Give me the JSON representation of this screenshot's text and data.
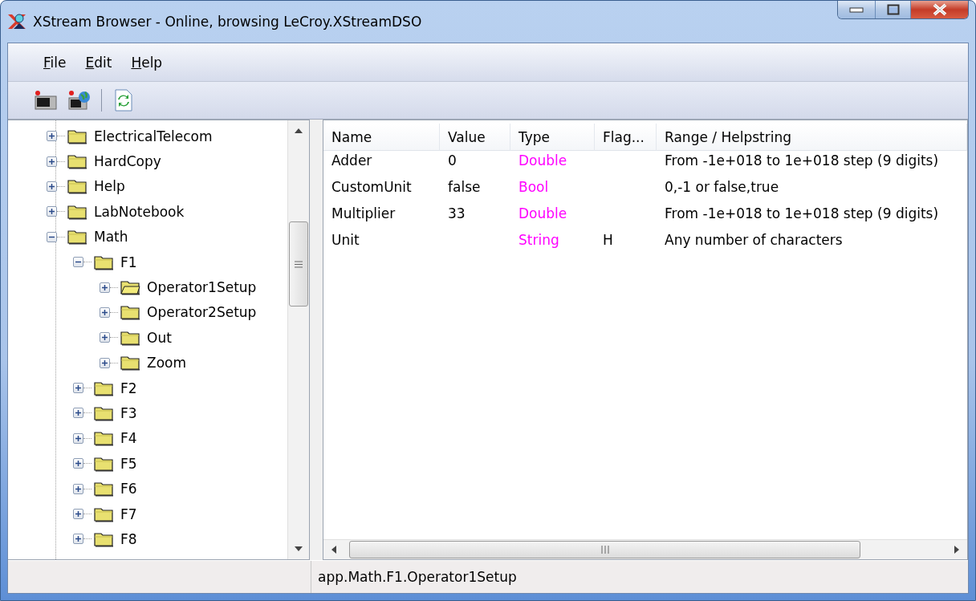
{
  "window": {
    "title": "XStream Browser - Online, browsing LeCroy.XStreamDSO"
  },
  "menu": [
    {
      "label": "File"
    },
    {
      "label": "Edit"
    },
    {
      "label": "Help"
    }
  ],
  "tree": [
    {
      "label": "ElectricalTelecom",
      "expanded": false,
      "selected": false
    },
    {
      "label": "HardCopy",
      "expanded": false,
      "selected": false
    },
    {
      "label": "Help",
      "expanded": false,
      "selected": false
    },
    {
      "label": "LabNotebook",
      "expanded": false,
      "selected": false
    },
    {
      "label": "Math",
      "expanded": true,
      "selected": false,
      "children": [
        {
          "label": "F1",
          "expanded": true,
          "selected": false,
          "children": [
            {
              "label": "Operator1Setup",
              "expanded": false,
              "selected": true
            },
            {
              "label": "Operator2Setup",
              "expanded": false,
              "selected": false
            },
            {
              "label": "Out",
              "expanded": false,
              "selected": false
            },
            {
              "label": "Zoom",
              "expanded": false,
              "selected": false
            }
          ]
        },
        {
          "label": "F2",
          "expanded": false,
          "selected": false
        },
        {
          "label": "F3",
          "expanded": false,
          "selected": false
        },
        {
          "label": "F4",
          "expanded": false,
          "selected": false
        },
        {
          "label": "F5",
          "expanded": false,
          "selected": false
        },
        {
          "label": "F6",
          "expanded": false,
          "selected": false
        },
        {
          "label": "F7",
          "expanded": false,
          "selected": false
        },
        {
          "label": "F8",
          "expanded": false,
          "selected": false
        }
      ]
    }
  ],
  "table": {
    "columns": [
      "Name",
      "Value",
      "Type",
      "Flag...",
      "Range / Helpstring"
    ],
    "rows": [
      [
        "Adder",
        "0",
        "Double",
        "",
        "From -1e+018 to 1e+018 step (9 digits)"
      ],
      [
        "CustomUnit",
        "false",
        "Bool",
        "",
        "0,-1 or false,true"
      ],
      [
        "Multiplier",
        "33",
        "Double",
        "",
        "From -1e+018 to 1e+018 step (9 digits)"
      ],
      [
        "Unit",
        "",
        "String",
        "H",
        "Any number of characters"
      ]
    ]
  },
  "status_bar": {
    "path": "app.Math.F1.Operator1Setup"
  }
}
